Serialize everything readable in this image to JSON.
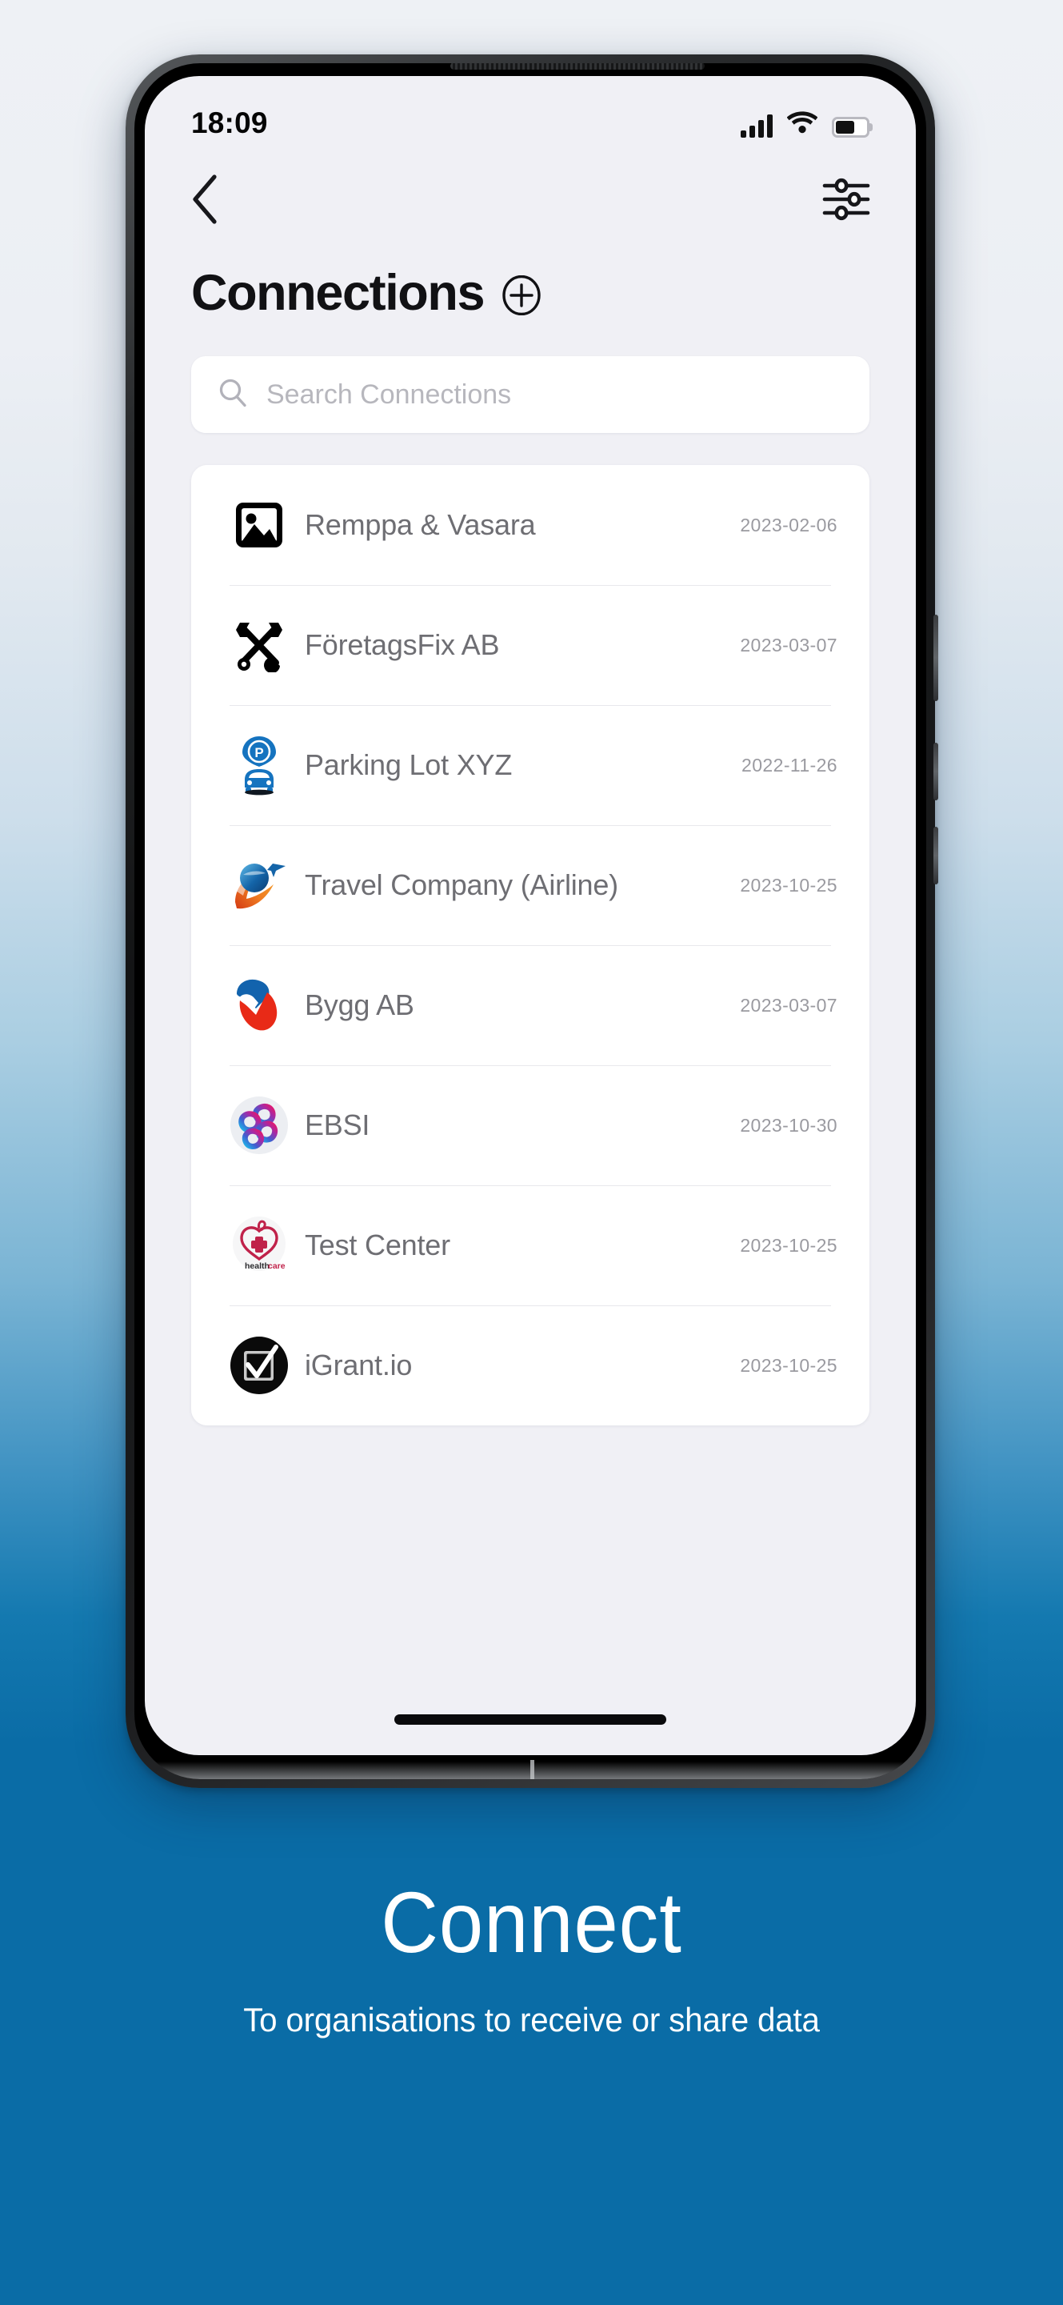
{
  "status_bar": {
    "time": "18:09",
    "signal_icon": "cellular-signal-icon",
    "wifi_icon": "wifi-icon",
    "battery_icon": "battery-icon",
    "battery_level_percent": 62
  },
  "nav": {
    "back_icon": "chevron-left-icon",
    "filter_icon": "sliders-filter-icon"
  },
  "header": {
    "title": "Connections",
    "add_icon": "plus-circle-icon"
  },
  "search": {
    "icon": "search-icon",
    "value": "",
    "placeholder": "Search Connections"
  },
  "connections": [
    {
      "name": "Remppa & Vasara",
      "date": "2023-02-06",
      "logo": "image-placeholder-icon"
    },
    {
      "name": "FöretagsFix AB",
      "date": "2023-03-07",
      "logo": "crossed-tools-icon"
    },
    {
      "name": "Parking Lot XYZ",
      "date": "2022-11-26",
      "logo": "parking-car-icon"
    },
    {
      "name": "Travel Company (Airline)",
      "date": "2023-10-25",
      "logo": "globe-airplane-icon"
    },
    {
      "name": "Bygg AB",
      "date": "2023-03-07",
      "logo": "checkmark-swoosh-icon"
    },
    {
      "name": "EBSI",
      "date": "2023-10-30",
      "logo": "ebsi-loops-icon"
    },
    {
      "name": "Test Center",
      "date": "2023-10-25",
      "logo": "healthcare-heart-icon"
    },
    {
      "name": "iGrant.io",
      "date": "2023-10-25",
      "logo": "igrant-checkbox-icon"
    }
  ],
  "caption": {
    "title": "Connect",
    "subtitle": "To organisations to receive or share data"
  },
  "colors": {
    "poster_bottom": "#0a6ca6",
    "screen_background": "#f0f0f5",
    "card_background": "#ffffff",
    "primary_text": "#111114",
    "secondary_text": "#6e6e73",
    "date_text": "#9a9aa0",
    "caption_text": "#ffffff"
  }
}
